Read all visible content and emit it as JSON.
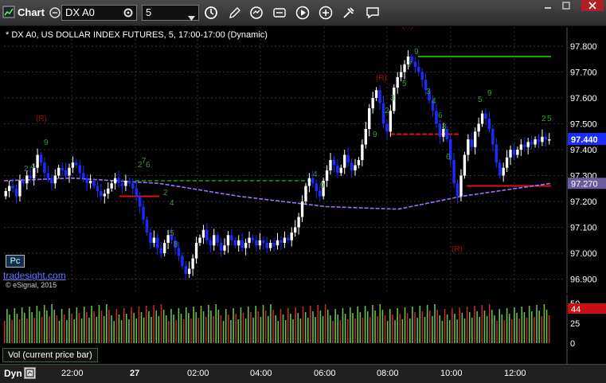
{
  "toolbar": {
    "title": "Chart",
    "symbol": "DX A0",
    "interval": "5",
    "icons": [
      "chart-icon",
      "link-icon",
      "settings-icon",
      "clock-icon",
      "pencil-icon",
      "refresh-icon",
      "flag-icon",
      "play-icon",
      "tools-icon",
      "comment-icon"
    ],
    "window_buttons": [
      "restore-icon",
      "maximize-icon",
      "close-icon"
    ]
  },
  "chart": {
    "title": "* DX A0, US DOLLAR INDEX FUTURES, 5, 17:00-17:00 (Dynamic)",
    "badge": "Pc",
    "watermark_link": "tradesight.com",
    "watermark_copy": "© eSignal, 2015",
    "current_price": "97.440",
    "ma_price": "97.270",
    "price_ticks": [
      "97.800",
      "97.700",
      "97.600",
      "97.500",
      "97.400",
      "97.300",
      "97.200",
      "97.100",
      "97.000",
      "96.900"
    ],
    "annotation_R": "(R)",
    "colors": {
      "up": "#ffffff",
      "down": "#1a2cff",
      "ma": "#a070ff",
      "green_level": "#00b000",
      "red_level": "#e01010",
      "count": "#3a9a3a"
    }
  },
  "volume": {
    "label": "Vol (current price bar)",
    "ticks": [
      "50",
      "25",
      "0"
    ],
    "current": "44",
    "colors": {
      "up": "#6cc04a",
      "down": "#c03020"
    }
  },
  "time_axis": {
    "mode": "Dyn",
    "labels": [
      "22:00",
      "27",
      "02:00",
      "04:00",
      "06:00",
      "08:00",
      "10:00",
      "12:00"
    ]
  },
  "chart_data": {
    "type": "candlestick",
    "title": "* DX A0, US DOLLAR INDEX FUTURES, 5, 17:00-17:00 (Dynamic)",
    "y_ticks": [
      97.8,
      97.7,
      97.6,
      97.5,
      97.4,
      97.3,
      97.2,
      97.1,
      97.0,
      96.9
    ],
    "x_labels": [
      "22:00",
      "27",
      "02:00",
      "04:00",
      "06:00",
      "08:00",
      "10:00",
      "12:00"
    ],
    "last_price": 97.44,
    "moving_average_last": 97.27,
    "close_path": [
      97.24,
      97.26,
      97.25,
      97.22,
      97.28,
      97.27,
      97.3,
      97.29,
      97.33,
      97.38,
      97.35,
      97.31,
      97.29,
      97.27,
      97.3,
      97.33,
      97.32,
      97.3,
      97.33,
      97.35,
      97.34,
      97.31,
      97.29,
      97.27,
      97.28,
      97.26,
      97.24,
      97.22,
      97.23,
      97.25,
      97.27,
      97.29,
      97.27,
      97.26,
      97.28,
      97.27,
      97.25,
      97.22,
      97.18,
      97.13,
      97.08,
      97.04,
      97.06,
      97.02,
      97.0,
      97.04,
      97.07,
      97.05,
      97.02,
      96.99,
      96.95,
      96.92,
      96.94,
      96.98,
      97.04,
      97.06,
      97.09,
      97.05,
      97.03,
      97.07,
      97.04,
      97.01,
      97.03,
      97.07,
      97.05,
      97.03,
      97.05,
      97.02,
      97.04,
      97.06,
      97.05,
      97.03,
      97.05,
      97.04,
      97.02,
      97.04,
      97.03,
      97.05,
      97.04,
      97.06,
      97.05,
      97.08,
      97.1,
      97.14,
      97.2,
      97.26,
      97.29,
      97.27,
      97.24,
      97.22,
      97.28,
      97.32,
      97.36,
      97.34,
      97.31,
      97.33,
      97.38,
      97.35,
      97.32,
      97.34,
      97.36,
      97.42,
      97.48,
      97.56,
      97.6,
      97.63,
      97.58,
      97.5,
      97.47,
      97.55,
      97.64,
      97.68,
      97.7,
      97.73,
      97.76,
      97.74,
      97.72,
      97.7,
      97.67,
      97.63,
      97.59,
      97.55,
      97.5,
      97.45,
      97.48,
      97.44,
      97.36,
      97.27,
      97.22,
      97.3,
      97.38,
      97.44,
      97.41,
      97.47,
      97.5,
      97.54,
      97.52,
      97.48,
      97.42,
      97.35,
      97.3,
      97.33,
      97.37,
      97.4,
      97.38,
      97.4,
      97.42,
      97.41,
      97.43,
      97.42,
      97.44,
      97.43,
      97.45,
      97.44,
      97.44
    ],
    "moving_average": [
      97.28,
      97.29,
      97.27,
      97.22,
      97.18,
      97.17,
      97.22,
      97.27
    ]
  }
}
